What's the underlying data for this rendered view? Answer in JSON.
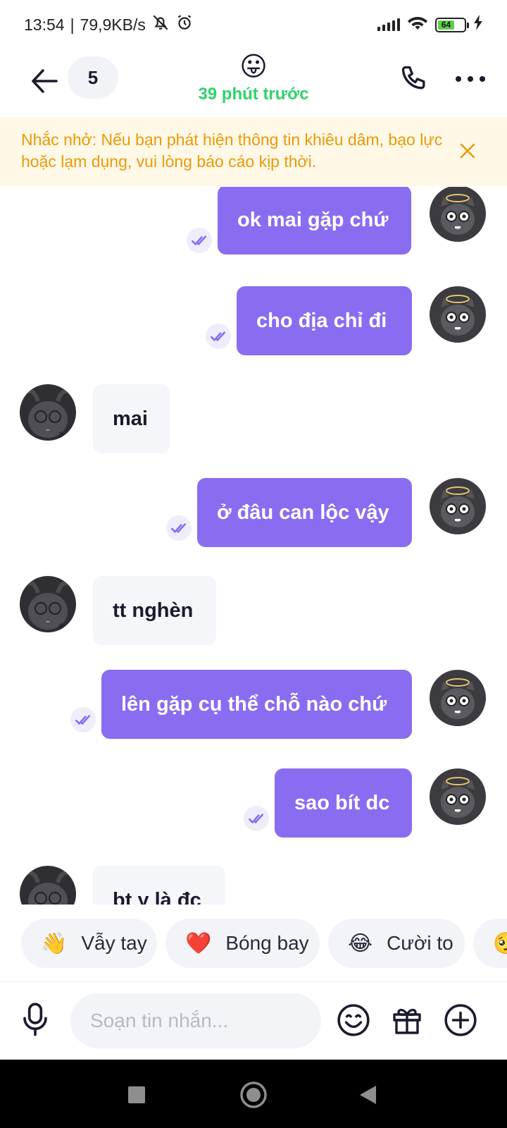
{
  "status_bar": {
    "time": "13:54",
    "separator": "|",
    "network_speed": "79,9KB/s",
    "battery_level": "64"
  },
  "header": {
    "unread_count": "5",
    "contact_emoji": "😛",
    "last_seen": "39 phút trước"
  },
  "warning": {
    "text": "Nhắc nhở: Nếu bạn phát hiện thông tin khiêu dâm, bạo lực hoặc lạm dụng, vui lòng báo cáo kịp thời."
  },
  "messages": [
    {
      "direction": "out",
      "text": "ok mai gặp chứ",
      "status": "read"
    },
    {
      "direction": "out",
      "text": "cho địa chỉ đi",
      "status": "read"
    },
    {
      "direction": "in",
      "text": "mai"
    },
    {
      "direction": "out",
      "text": "ở đâu can lộc vậy",
      "status": "read"
    },
    {
      "direction": "in",
      "text": "tt nghèn"
    },
    {
      "direction": "out",
      "text": "lên gặp cụ thể chỗ nào chứ",
      "status": "read"
    },
    {
      "direction": "out",
      "text": "sao bít dc",
      "status": "read"
    },
    {
      "direction": "in",
      "text": "bt y là đc"
    }
  ],
  "quick_reactions": [
    {
      "emoji": "👋",
      "label": "Vẫy tay"
    },
    {
      "emoji": "❤️",
      "label": "Bóng bay"
    },
    {
      "emoji": "😂",
      "label": "Cười to"
    },
    {
      "emoji": "🥺",
      "label": ""
    }
  ],
  "composer": {
    "placeholder": "Soạn tin nhắn..."
  },
  "colors": {
    "accent": "#8a6cf1",
    "online": "#2fd36a",
    "warning_text": "#e89a0b",
    "warning_bg": "#fff8e6"
  }
}
